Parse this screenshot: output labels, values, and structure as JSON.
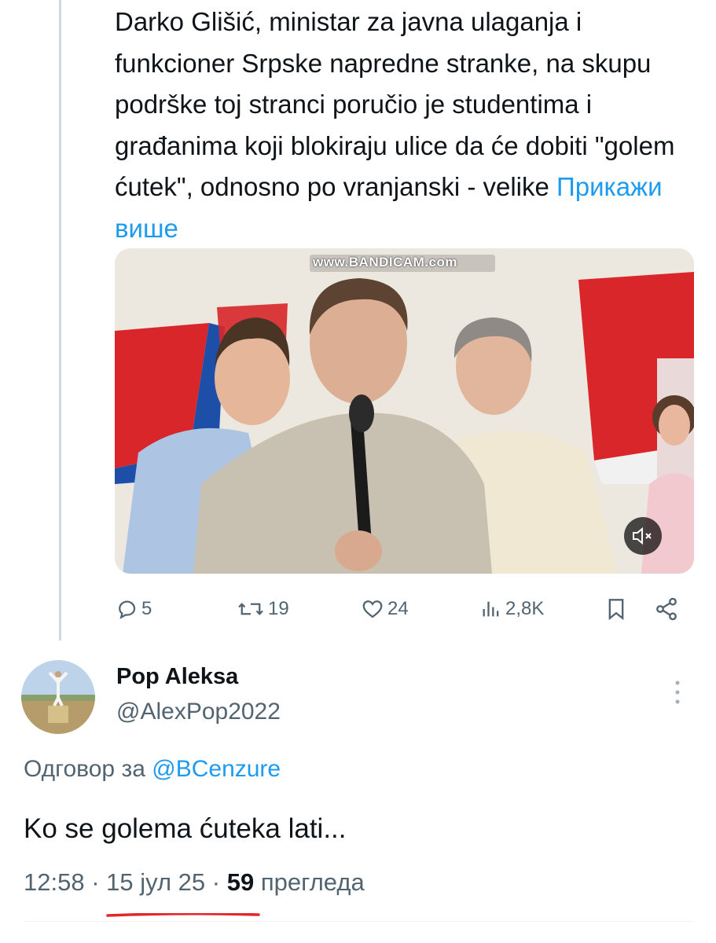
{
  "tweet": {
    "text": "Darko Glišić, ministar za javna ulaganja i funkcioner Srpske napredne stranke, na skupu podrške toj stranci poručio je studentima i građanima koji blokiraju ulice da će dobiti \"golem ćutek\", odnosno po vranjanski - velike",
    "show_more": "Прикажи више",
    "media": {
      "watermark": "www.BANDICAM.com",
      "mute_icon": "speaker-muted-icon"
    },
    "actions": {
      "replies": "5",
      "retweets": "19",
      "likes": "24",
      "views": "2,8K"
    }
  },
  "reply": {
    "name": "Pop Aleksa",
    "handle": "@AlexPop2022",
    "reply_to_prefix": "Одговор за",
    "reply_to_handle": "@BCenzure",
    "text": "Ko se golema ćuteka lati...",
    "time": "12:58",
    "date": "15 јул 25",
    "views_count": "59",
    "views_label": "прегледа",
    "separator": "·"
  },
  "colors": {
    "link": "#1d9bf0",
    "secondary_text": "#536471",
    "annotation_underline": "#e3262a"
  }
}
